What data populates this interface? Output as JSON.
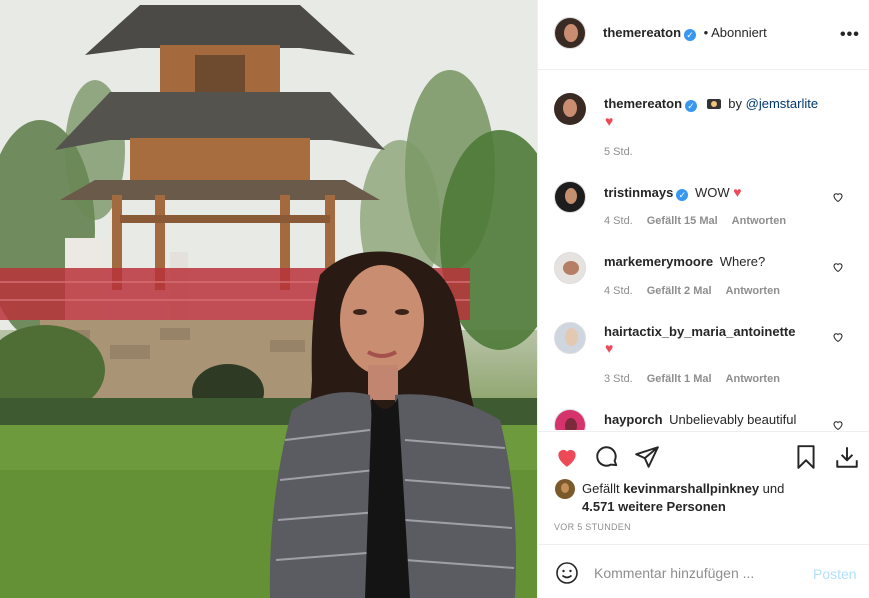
{
  "post": {
    "author": "themereaton",
    "follow_status": "• Abonniert",
    "more_icon": "more-dots-icon"
  },
  "caption": {
    "username": "themereaton",
    "camera_icon": "camera-icon",
    "by": "by",
    "mention": "@jemstarlite",
    "time": "5 Std."
  },
  "comments": [
    {
      "username": "tristinmays",
      "verified": true,
      "text": "WOW",
      "time": "4 Std.",
      "likes": "Gefällt 15 Mal",
      "reply": "Antworten"
    },
    {
      "username": "markemerymoore",
      "verified": false,
      "text": "Where?",
      "time": "4 Std.",
      "likes": "Gefällt 2 Mal",
      "reply": "Antworten"
    },
    {
      "username": "hairtactix_by_maria_antoinette",
      "verified": false,
      "text": "",
      "time": "3 Std.",
      "likes": "Gefällt 1 Mal",
      "reply": "Antworten"
    },
    {
      "username": "hayporch",
      "verified": false,
      "text": "Unbelievably beautiful"
    }
  ],
  "likes": {
    "prefix": "Gefällt",
    "user": "kevinmarshallpinkney",
    "conj": "und",
    "others": "4.571 weitere Personen",
    "timestamp": "VOR 5 STUNDEN"
  },
  "add_comment": {
    "placeholder": "Kommentar hinzufügen ...",
    "post_label": "Posten"
  },
  "colors": {
    "accent_blue": "#3897f0",
    "like_red": "#ed4956",
    "post_disabled": "#b2dffc",
    "muted": "#8e8e8e"
  }
}
